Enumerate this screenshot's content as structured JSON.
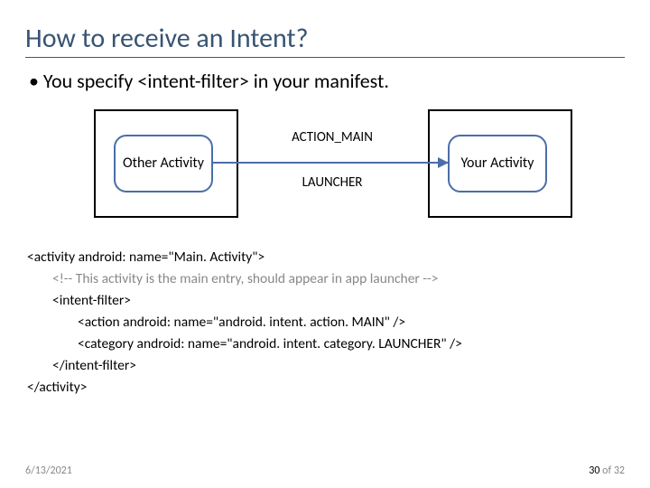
{
  "title": "How to receive an Intent?",
  "bullet": "• You specify <intent-filter> in your manifest.",
  "diagram": {
    "node_left": "Other Activity",
    "node_right": "Your Activity",
    "label_top": "ACTION_MAIN",
    "label_bottom": "LAUNCHER"
  },
  "code": {
    "l1": "<activity android: name=\"Main. Activity\">",
    "l2": "<!-- This activity is the main entry, should appear in app launcher -->",
    "l3": "<intent-filter>",
    "l4": "<action android: name=\"android. intent. action. MAIN\" />",
    "l5": "<category android: name=\"android. intent. category. LAUNCHER\" />",
    "l6": "</intent-filter>",
    "l7": "</activity>"
  },
  "footer": {
    "date": "6/13/2021",
    "page_current": "30",
    "page_sep": " of 32"
  }
}
